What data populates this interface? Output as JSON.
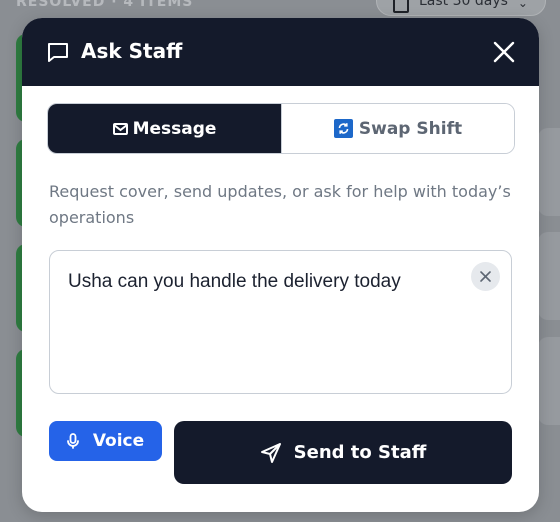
{
  "background": {
    "resolved_label": "RESOLVED · 4 ITEMS",
    "filter_label": "Last 30 days"
  },
  "modal": {
    "title": "Ask Staff",
    "tabs": [
      {
        "label": "Message",
        "icon": "mail-icon",
        "selected": true
      },
      {
        "label": "Swap Shift",
        "icon": "swap-icon",
        "selected": false
      }
    ],
    "description": "Request cover, send updates, or ask for help with today’s operations",
    "message_value": "Usha can you handle the delivery today",
    "voice_label": "Voice",
    "send_label": "Send to Staff"
  },
  "colors": {
    "header_bg": "#141a2b",
    "voice_blue": "#2563e8",
    "status_green": "#2f7d41"
  }
}
